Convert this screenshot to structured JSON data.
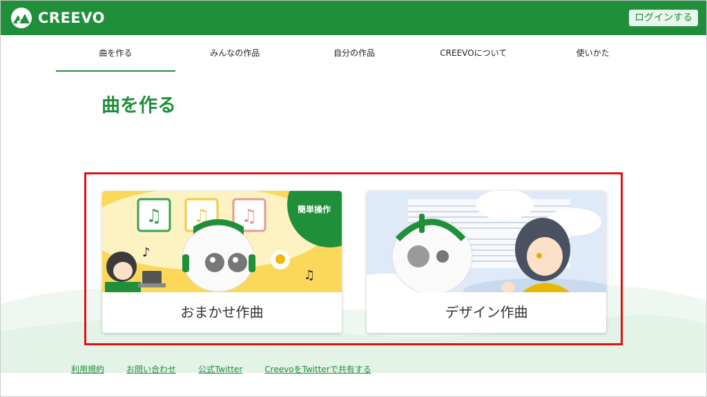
{
  "header": {
    "brand": "CREEVO",
    "login_label": "ログインする"
  },
  "nav": {
    "items": [
      {
        "label": "曲を作る",
        "active": true
      },
      {
        "label": "みんなの作品"
      },
      {
        "label": "自分の作品"
      },
      {
        "label": "CREEVOについて"
      },
      {
        "label": "使いかた"
      }
    ]
  },
  "page": {
    "title": "曲を作る"
  },
  "cards": [
    {
      "label": "おまかせ作曲",
      "badge": "簡単操作"
    },
    {
      "label": "デザイン作曲"
    }
  ],
  "footer": {
    "links": [
      "利用規約",
      "お問い合わせ",
      "公式Twitter",
      "CreevoをTwitterで共有する"
    ]
  },
  "colors": {
    "brand_green": "#1f8f3a",
    "highlight_red": "#e01010",
    "card1_bg": "#fbd85a",
    "card2_bg": "#dfeaf8"
  },
  "icons": [
    "creevo-logo-icon",
    "music-note-icon",
    "robot-character",
    "girl-character",
    "lightbulb-icon"
  ]
}
